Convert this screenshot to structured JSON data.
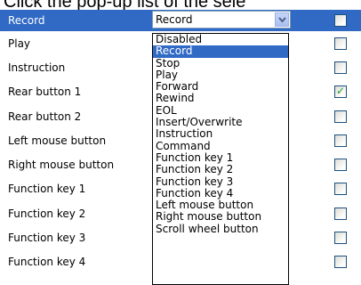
{
  "top_text": "Click the pop-up list of the sele",
  "rows": [
    {
      "label": "Record",
      "checked": false,
      "selected": true
    },
    {
      "label": "Play",
      "checked": false
    },
    {
      "label": "Instruction",
      "checked": false
    },
    {
      "label": "Rear button 1",
      "checked": true
    },
    {
      "label": "Rear button 2",
      "checked": false
    },
    {
      "label": "Left mouse button",
      "checked": false
    },
    {
      "label": "Right mouse button",
      "checked": false
    },
    {
      "label": "Function key 1",
      "checked": false
    },
    {
      "label": "Function key 2",
      "checked": false
    },
    {
      "label": "Function key 3",
      "checked": false
    },
    {
      "label": "Function key 4",
      "checked": false
    }
  ],
  "combo": {
    "value": "Record",
    "button_icon": "chevron-down-icon"
  },
  "dropdown": {
    "highlighted": "Record",
    "items": [
      "Disabled",
      "Record",
      "Stop",
      "Play",
      "Forward",
      "Rewind",
      "EOL",
      "Insert/Overwrite",
      "Instruction",
      "Command",
      "Function key 1",
      "Function key 2",
      "Function key 3",
      "Function key 4",
      "Left mouse button",
      "Right mouse button",
      "Scroll wheel button"
    ]
  },
  "colors": {
    "selection": "#316ac5",
    "check": "#21a121"
  }
}
